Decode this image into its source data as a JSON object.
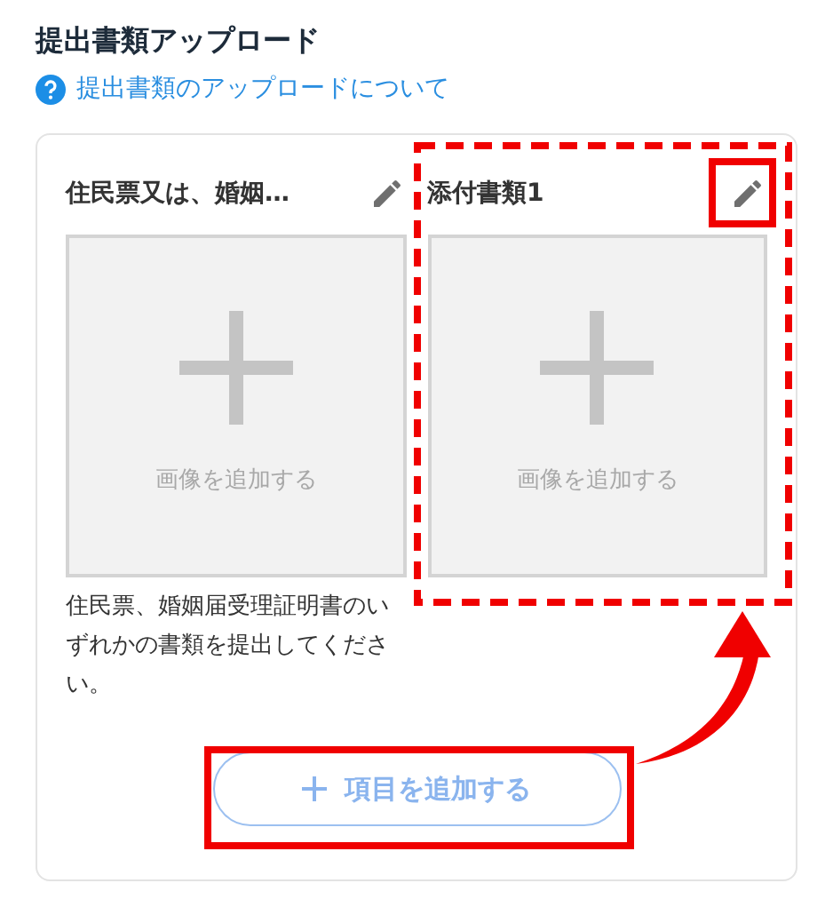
{
  "heading": "提出書類アップロード",
  "help_link": {
    "label": "提出書類のアップロードについて"
  },
  "documents": [
    {
      "title": "住民票又は、婚姻…",
      "upload_label": "画像を追加する",
      "description": "住民票、婚姻届受理証明書のいずれかの書類を提出してください。"
    },
    {
      "title": "添付書類1",
      "upload_label": "画像を追加する"
    }
  ],
  "add_button": {
    "label": "項目を追加する"
  }
}
